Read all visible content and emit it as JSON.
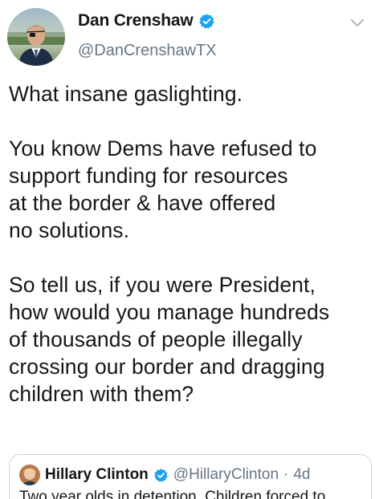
{
  "author": {
    "display_name": "Dan Crenshaw",
    "handle": "@DanCrenshawTX",
    "verified": true
  },
  "tweet": {
    "paragraphs": [
      "What insane gaslighting.",
      "You know Dems have refused to\nsupport funding for resources\nat the border & have offered\nno solutions.",
      "So tell us, if you were President,\nhow would you manage hundreds\nof thousands of people illegally\ncrossing our border and dragging\nchildren with them?"
    ]
  },
  "quoted_tweet": {
    "display_name": "Hillary Clinton",
    "handle": "@HillaryClinton",
    "separator": "·",
    "time": "4d",
    "verified": true,
    "text": "Two year olds in detention. Children forced to"
  },
  "colors": {
    "verified_blue": "#1da1f2",
    "secondary_text": "#657786",
    "border": "#ccd6dd"
  },
  "icons": {
    "menu": "chevron-down-icon",
    "verified": "verified-badge-icon"
  }
}
